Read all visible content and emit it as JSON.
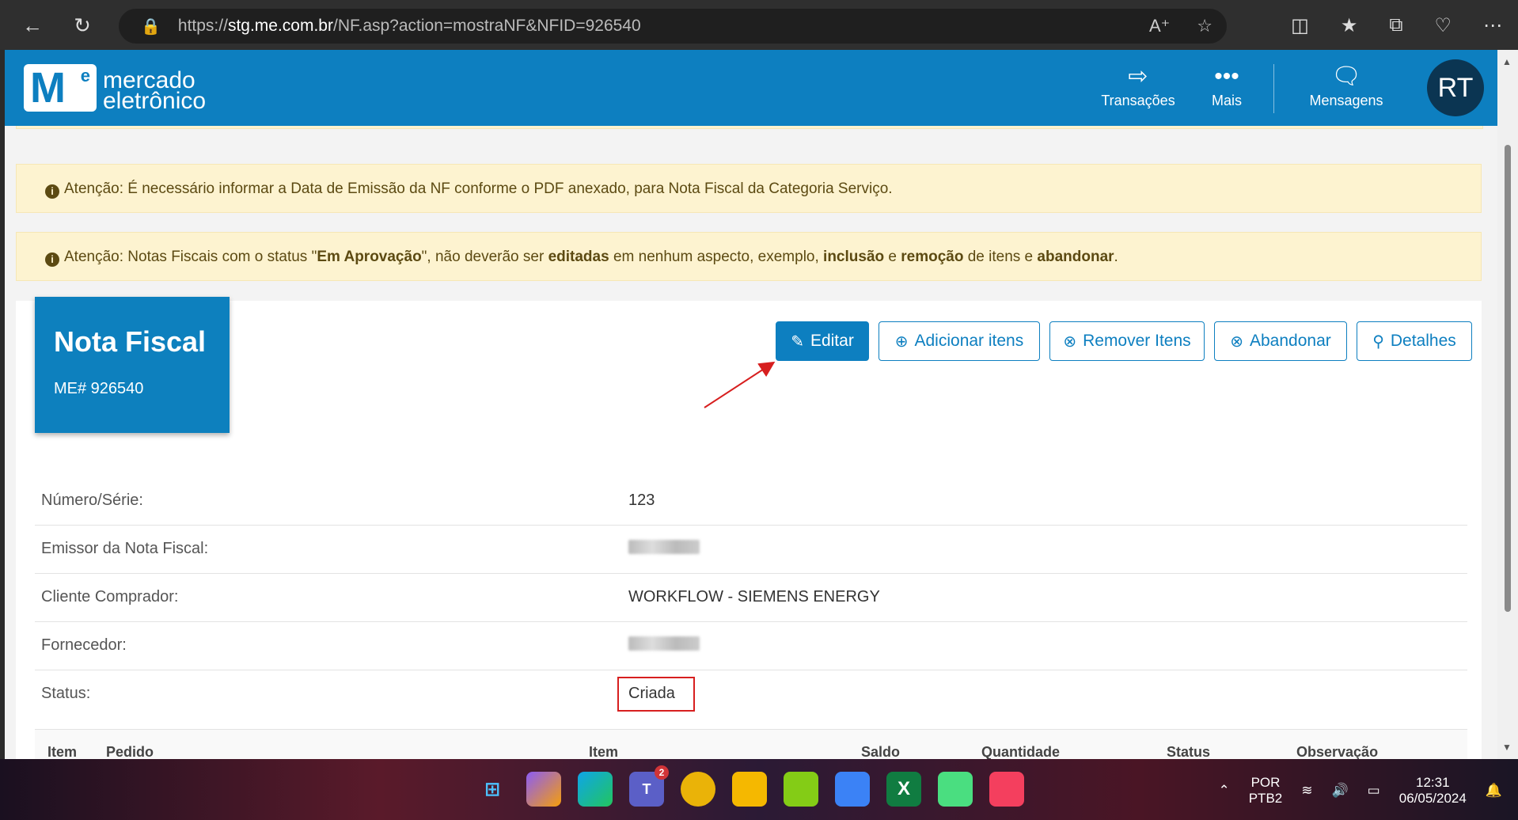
{
  "browser": {
    "url_prefix": "https://",
    "url_host": "stg.me.com.br",
    "url_path": "/NF.asp?action=mostraNF&NFID=926540"
  },
  "header": {
    "logo_line1": "mercado",
    "logo_line2": "eletrônico",
    "nav": [
      {
        "label": "Transações"
      },
      {
        "label": "Mais"
      },
      {
        "label": "Mensagens"
      }
    ],
    "avatar_initials": "RT"
  },
  "alerts": {
    "alert1": "Atenção: É necessário informar a Data de Emissão da NF conforme o PDF anexado, para Nota Fiscal da Categoria Serviço.",
    "alert2_p1": "Atenção: Notas Fiscais com o status \"",
    "alert2_b1": "Em Aprovação",
    "alert2_p2": "\", não deverão ser ",
    "alert2_b2": "editadas",
    "alert2_p3": " em nenhum aspecto, exemplo, ",
    "alert2_b3": "inclusão",
    "alert2_p4": " e ",
    "alert2_b4": "remoção",
    "alert2_p5": " de itens e ",
    "alert2_b5": "abandonar",
    "alert2_p6": "."
  },
  "nf": {
    "title": "Nota Fiscal",
    "me_number": "ME# 926540"
  },
  "actions": {
    "edit": "Editar",
    "add_items": "Adicionar itens",
    "remove_items": "Remover Itens",
    "abandon": "Abandonar",
    "details": "Detalhes"
  },
  "details": {
    "numero_label": "Número/Série:",
    "numero_value": "123",
    "emissor_label": "Emissor da Nota Fiscal:",
    "cliente_label": "Cliente Comprador:",
    "cliente_value": "WORKFLOW - SIEMENS ENERGY",
    "fornecedor_label": "Fornecedor:",
    "status_label": "Status:",
    "status_value": "Criada"
  },
  "table": {
    "columns": [
      "Item",
      "Pedido",
      "Item",
      "Saldo",
      "Quantidade",
      "Status",
      "Observação"
    ]
  },
  "taskbar": {
    "teams_badge": "2",
    "lang1": "POR",
    "lang2": "PTB2",
    "time": "12:31",
    "date": "06/05/2024"
  },
  "colors": {
    "brand_blue": "#0d7fc0",
    "alert_bg": "#fdf3d0",
    "status_highlight": "#d71f1f"
  }
}
